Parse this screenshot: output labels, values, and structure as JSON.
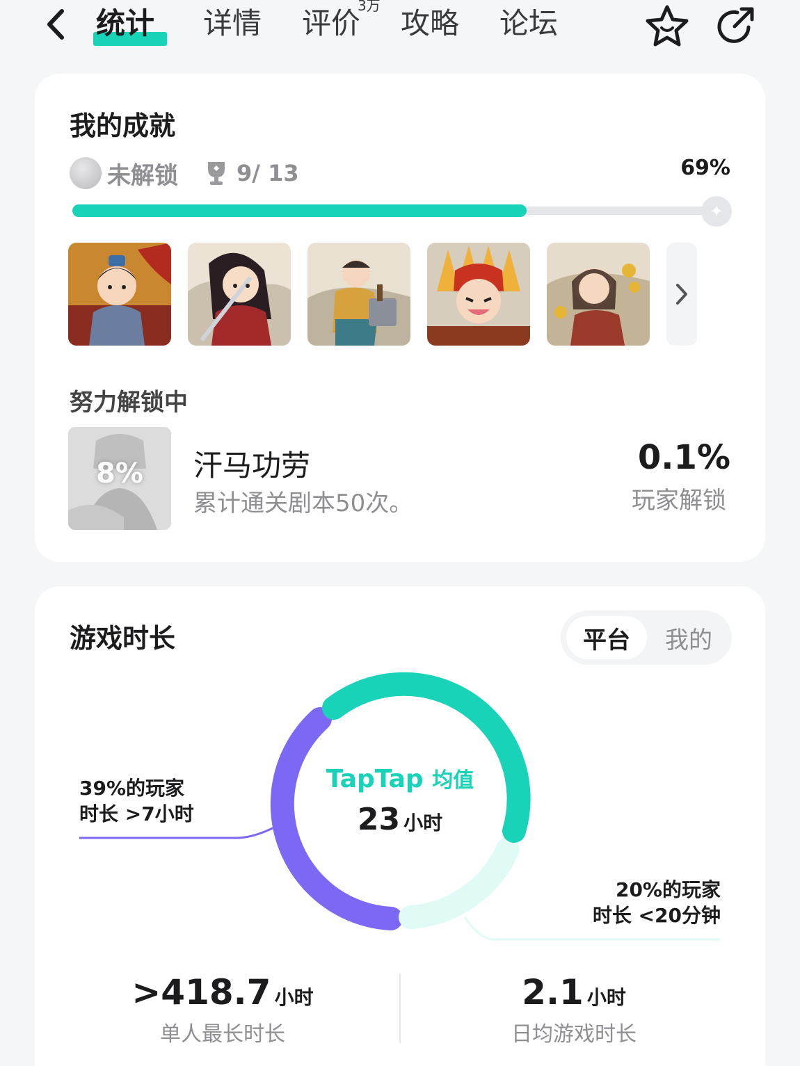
{
  "nav": {
    "tabs": [
      {
        "label": "统计",
        "active": true
      },
      {
        "label": "详情"
      },
      {
        "label": "评价",
        "badge": "3万"
      },
      {
        "label": "攻略"
      },
      {
        "label": "论坛"
      }
    ],
    "icons": [
      "back-icon",
      "star-face-icon",
      "share-icon"
    ]
  },
  "achievements": {
    "title": "我的成就",
    "status": "未解锁",
    "count": "9/ 13",
    "percent": "69%",
    "progress": 0.69,
    "badges": [
      "badge-general",
      "badge-swordswoman",
      "badge-hammer",
      "badge-chieftain",
      "badge-coins"
    ],
    "unlocking": {
      "title": "努力解锁中",
      "thumb_pct": "8%",
      "name": "汗马功劳",
      "desc": "累计通关剧本50次。",
      "rate": "0.1%",
      "rate_label": "玩家解锁"
    }
  },
  "playtime": {
    "title": "游戏时长",
    "toggle": {
      "active": "平台",
      "inactive": "我的"
    },
    "center": {
      "brand": "TapTap",
      "brand_suffix": "均值",
      "value": "23",
      "unit": "小时"
    },
    "left_note": {
      "line1": "39%的玩家",
      "line2": "时长 >7小时"
    },
    "right_note": {
      "line1": "20%的玩家",
      "line2": "时长 <20分钟"
    },
    "stats": [
      {
        "value": ">418.7",
        "unit": "小时",
        "label": "单人最长时长"
      },
      {
        "value": "2.1",
        "unit": "小时",
        "label": "日均游戏时长"
      }
    ],
    "colors": {
      "teal": "#19d3b9",
      "purple": "#7b68f5",
      "light": "#e0faf6"
    }
  }
}
